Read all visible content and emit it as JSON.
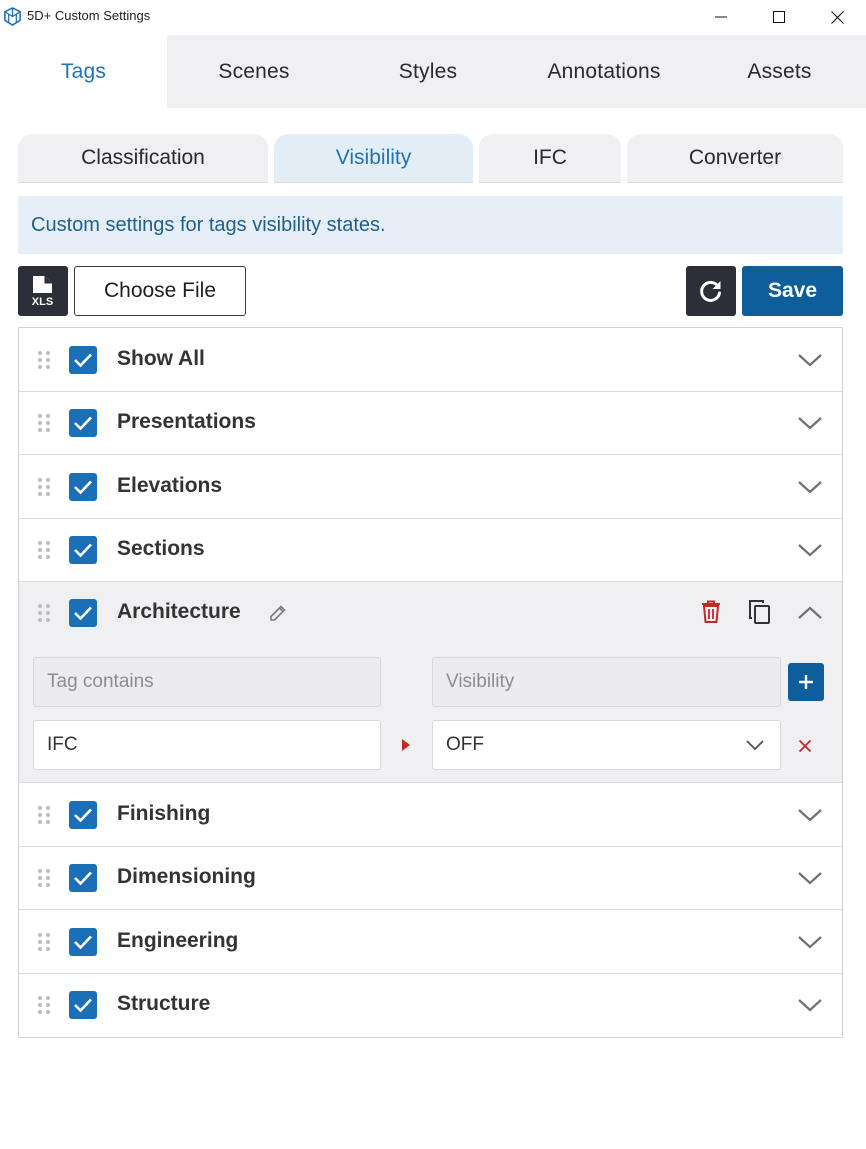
{
  "window": {
    "title": "5D+ Custom Settings"
  },
  "main_tabs": [
    {
      "label": "Tags"
    },
    {
      "label": "Scenes"
    },
    {
      "label": "Styles"
    },
    {
      "label": "Annotations"
    },
    {
      "label": "Assets"
    }
  ],
  "sub_tabs": [
    {
      "label": "Classification"
    },
    {
      "label": "Visibility"
    },
    {
      "label": "IFC"
    },
    {
      "label": "Converter"
    }
  ],
  "info_text": "Custom settings for tags visibility states.",
  "toolbar": {
    "xls_icon_label": "XLS",
    "choose_file_label": "Choose File",
    "save_label": "Save"
  },
  "rows": [
    {
      "label": "Show All",
      "checked": true
    },
    {
      "label": "Presentations",
      "checked": true
    },
    {
      "label": "Elevations",
      "checked": true
    },
    {
      "label": "Sections",
      "checked": true
    },
    {
      "label": "Architecture",
      "checked": true,
      "expanded": true
    },
    {
      "label": "Finishing",
      "checked": true
    },
    {
      "label": "Dimensioning",
      "checked": true
    },
    {
      "label": "Engineering",
      "checked": true
    },
    {
      "label": "Structure",
      "checked": true
    }
  ],
  "rule_editor": {
    "tag_placeholder": "Tag contains",
    "visibility_placeholder": "Visibility",
    "rules": [
      {
        "tag": "IFC",
        "visibility": "OFF"
      }
    ]
  },
  "colors": {
    "accent": "#1f73b7",
    "save_button": "#0e5e9c",
    "dark_button": "#2c2f38",
    "delete": "#c62828"
  }
}
